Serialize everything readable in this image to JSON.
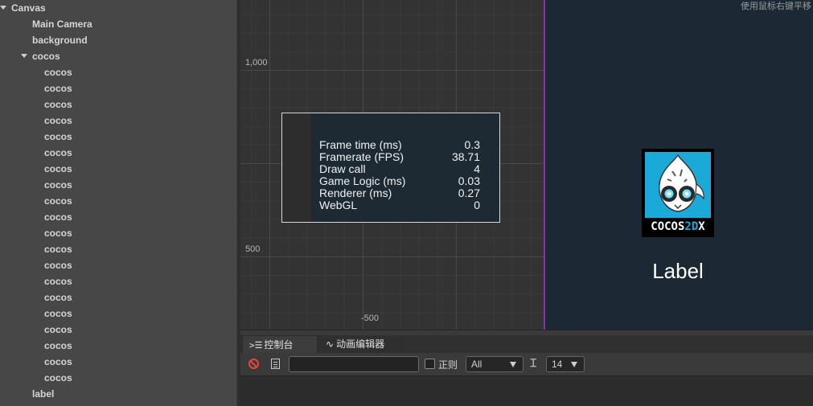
{
  "hierarchy": {
    "nodes": [
      {
        "label": "Canvas",
        "depth": 0,
        "expanded": true
      },
      {
        "label": "Main Camera",
        "depth": 1
      },
      {
        "label": "background",
        "depth": 1
      },
      {
        "label": "cocos",
        "depth": 1,
        "expanded": true
      },
      {
        "label": "cocos",
        "depth": 2
      },
      {
        "label": "cocos",
        "depth": 2
      },
      {
        "label": "cocos",
        "depth": 2
      },
      {
        "label": "cocos",
        "depth": 2
      },
      {
        "label": "cocos",
        "depth": 2
      },
      {
        "label": "cocos",
        "depth": 2
      },
      {
        "label": "cocos",
        "depth": 2
      },
      {
        "label": "cocos",
        "depth": 2
      },
      {
        "label": "cocos",
        "depth": 2
      },
      {
        "label": "cocos",
        "depth": 2
      },
      {
        "label": "cocos",
        "depth": 2
      },
      {
        "label": "cocos",
        "depth": 2
      },
      {
        "label": "cocos",
        "depth": 2
      },
      {
        "label": "cocos",
        "depth": 2
      },
      {
        "label": "cocos",
        "depth": 2
      },
      {
        "label": "cocos",
        "depth": 2
      },
      {
        "label": "cocos",
        "depth": 2
      },
      {
        "label": "cocos",
        "depth": 2
      },
      {
        "label": "cocos",
        "depth": 2
      },
      {
        "label": "cocos",
        "depth": 2
      },
      {
        "label": "label",
        "depth": 1
      }
    ]
  },
  "scene": {
    "hint": "使用鼠标右键平移",
    "axis_labels": {
      "y_top": "1,000",
      "y_mid": "500",
      "x_left": "-500"
    },
    "stats": [
      {
        "name": "Frame time (ms)",
        "value": "0.3"
      },
      {
        "name": "Framerate (FPS)",
        "value": "38.71"
      },
      {
        "name": "Draw call",
        "value": "4"
      },
      {
        "name": "Game Logic (ms)",
        "value": "0.03"
      },
      {
        "name": "Renderer (ms)",
        "value": "0.27"
      },
      {
        "name": "WebGL",
        "value": "0"
      }
    ],
    "logo_text_main": "COCOS",
    "logo_text_2d": "2D",
    "logo_text_x": "X",
    "label_text": "Label",
    "colors": {
      "game_bg": "#1c2833",
      "canvas_border": "#8b2fae",
      "logo_blue": "#1ba9d8"
    }
  },
  "console": {
    "tabs": [
      {
        "label": "控制台",
        "icon": "console-icon"
      },
      {
        "label": "动画编辑器",
        "icon": "animation-icon"
      }
    ],
    "search_value": "",
    "regex_label": "正则",
    "level_selected": "All",
    "font_size_selected": "14"
  }
}
